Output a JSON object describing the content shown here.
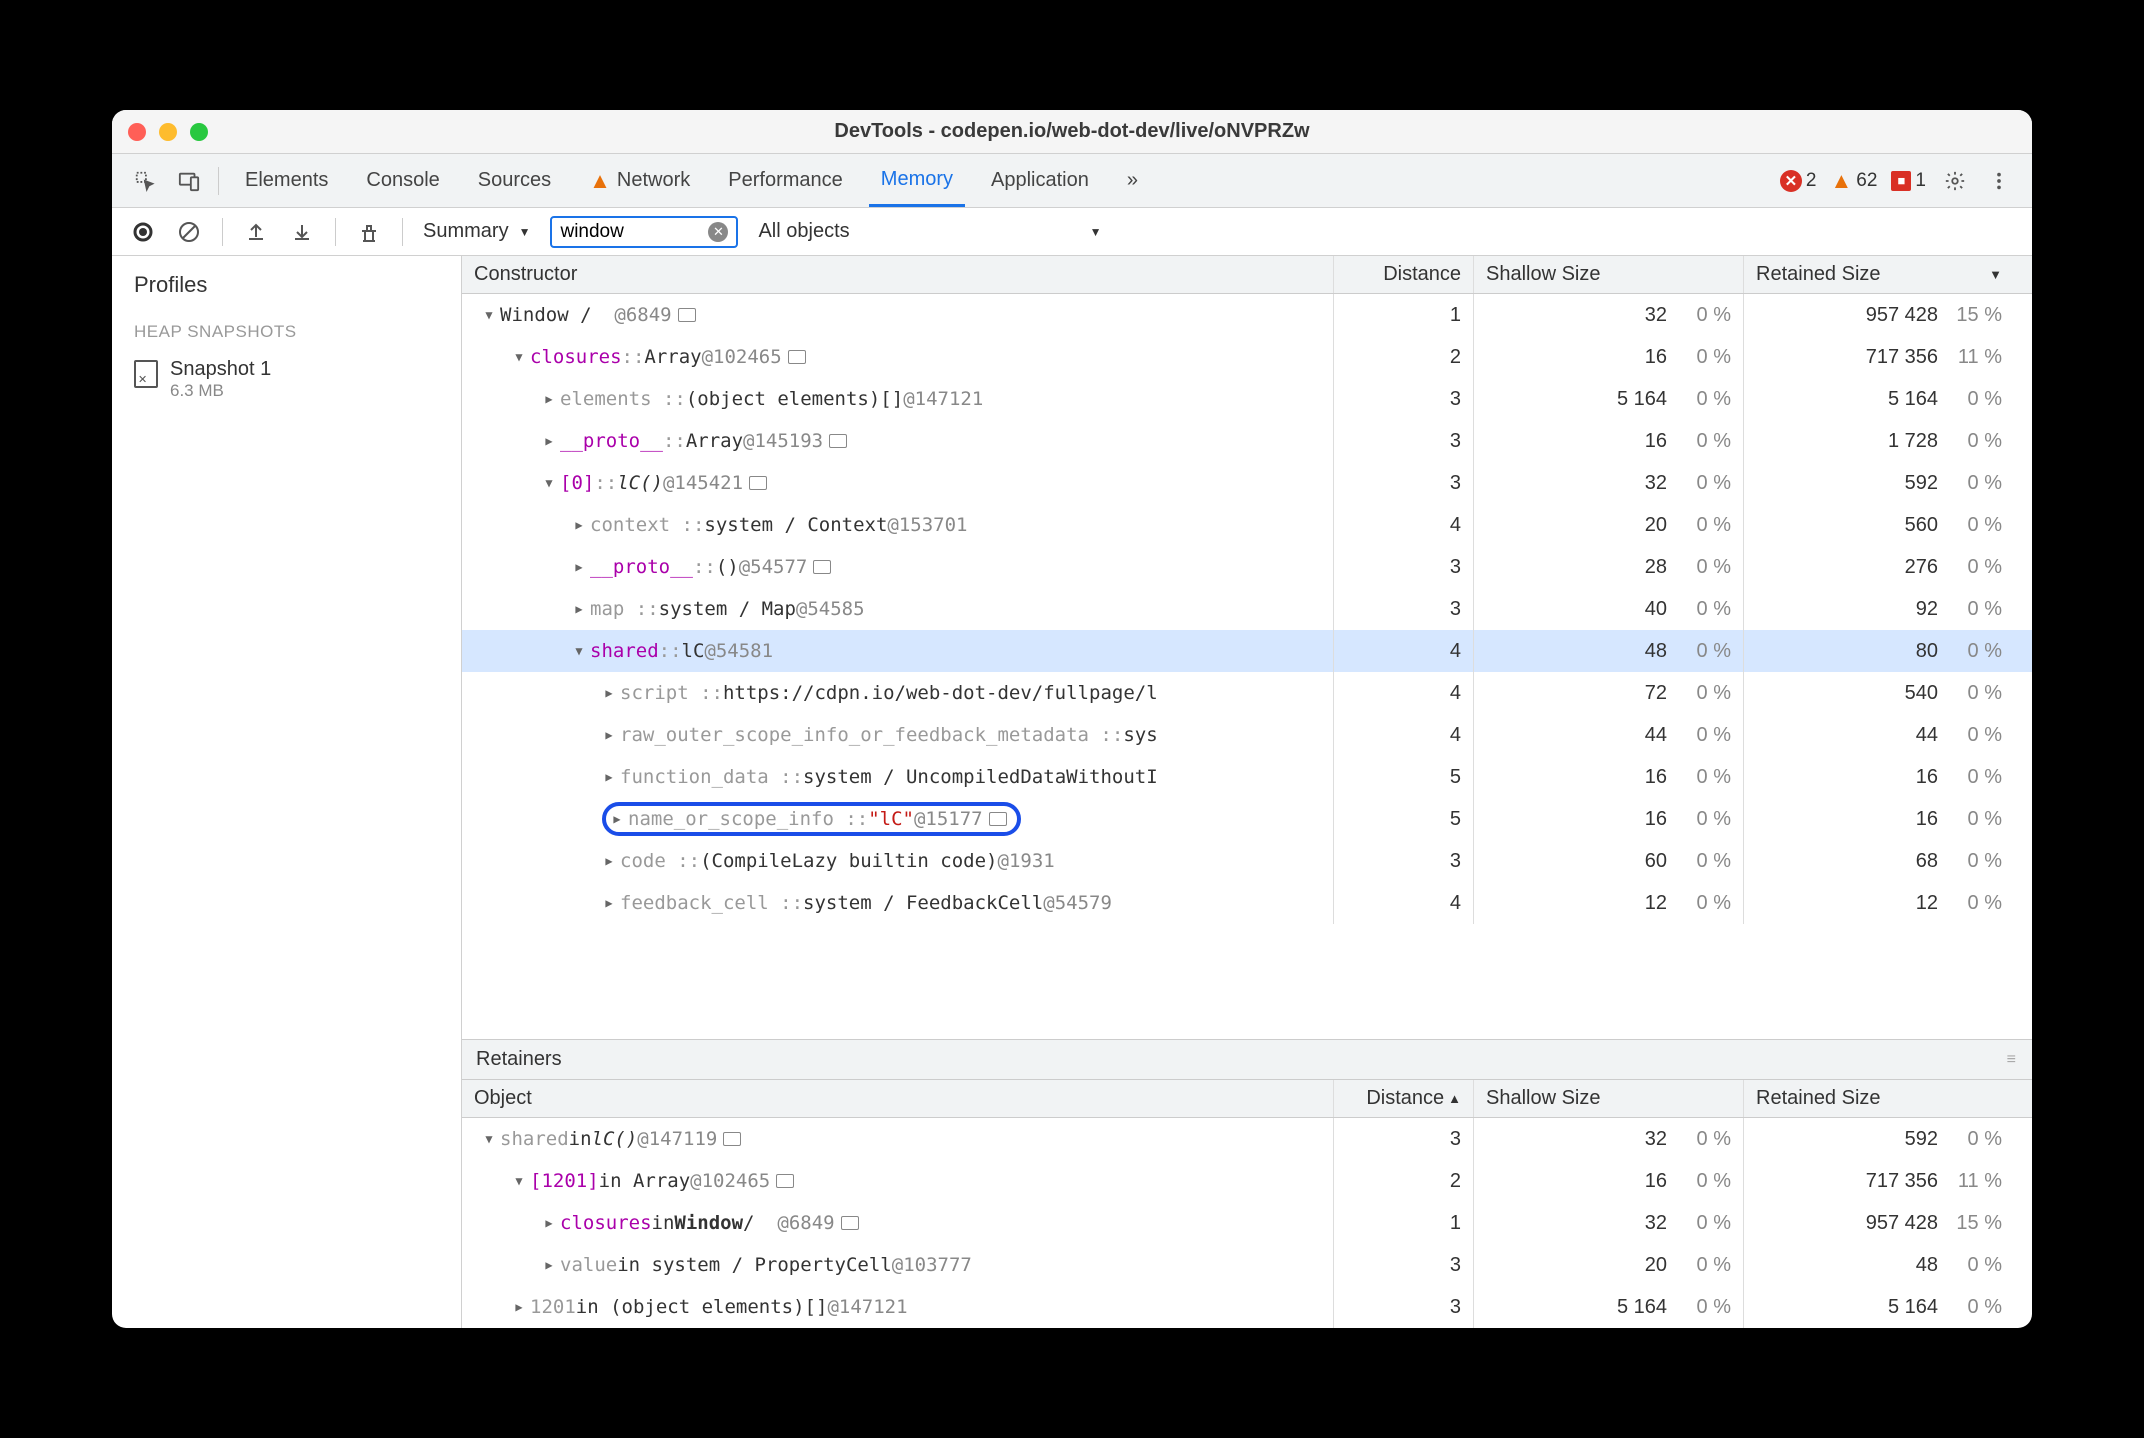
{
  "window": {
    "title": "DevTools - codepen.io/web-dot-dev/live/oNVPRZw"
  },
  "tabs": {
    "elements": "Elements",
    "console": "Console",
    "sources": "Sources",
    "network": "Network",
    "performance": "Performance",
    "memory": "Memory",
    "application": "Application",
    "more": "»"
  },
  "status": {
    "errors": "2",
    "warnings": "62",
    "issues": "1"
  },
  "toolbar": {
    "view_mode": "Summary",
    "filter_value": "window",
    "object_filter": "All objects"
  },
  "sidebar": {
    "title": "Profiles",
    "section": "HEAP SNAPSHOTS",
    "snapshot": {
      "name": "Snapshot 1",
      "size": "6.3 MB"
    }
  },
  "headers": {
    "constructor": "Constructor",
    "distance": "Distance",
    "shallow": "Shallow Size",
    "retained": "Retained Size",
    "object": "Object",
    "retainers": "Retainers"
  },
  "rows": [
    {
      "indent": 0,
      "expand": "open",
      "name_html": "Window / &nbsp;<span class='idref'>@6849</span> <span class='link-sq'></span>",
      "dist": "1",
      "shallow": "32",
      "shallow_pct": "0 %",
      "retained": "957 428",
      "retained_pct": "15 %"
    },
    {
      "indent": 1,
      "expand": "open",
      "name_html": "<span class='prop'>closures</span> <span class='gray'>::</span> Array <span class='idref'>@102465</span> <span class='link-sq'></span>",
      "dist": "2",
      "shallow": "16",
      "shallow_pct": "0 %",
      "retained": "717 356",
      "retained_pct": "11 %"
    },
    {
      "indent": 2,
      "expand": "closed",
      "name_html": "<span class='gray'>elements ::</span> (object elements)[] <span class='idref'>@147121</span>",
      "dist": "3",
      "shallow": "5 164",
      "shallow_pct": "0 %",
      "retained": "5 164",
      "retained_pct": "0 %"
    },
    {
      "indent": 2,
      "expand": "closed",
      "name_html": "<span class='prop'>__proto__</span> <span class='gray'>::</span> Array <span class='idref'>@145193</span> <span class='link-sq'></span>",
      "dist": "3",
      "shallow": "16",
      "shallow_pct": "0 %",
      "retained": "1 728",
      "retained_pct": "0 %"
    },
    {
      "indent": 2,
      "expand": "open",
      "name_html": "<span class='prop'>[0]</span> <span class='gray'>::</span> <i>lC()</i> <span class='idref'>@145421</span> <span class='link-sq'></span>",
      "dist": "3",
      "shallow": "32",
      "shallow_pct": "0 %",
      "retained": "592",
      "retained_pct": "0 %"
    },
    {
      "indent": 3,
      "expand": "closed",
      "name_html": "<span class='gray'>context ::</span> system / Context <span class='idref'>@153701</span>",
      "dist": "4",
      "shallow": "20",
      "shallow_pct": "0 %",
      "retained": "560",
      "retained_pct": "0 %"
    },
    {
      "indent": 3,
      "expand": "closed",
      "name_html": "<span class='prop'>__proto__</span> <span class='gray'>::</span> () <span class='idref'>@54577</span> <span class='link-sq'></span>",
      "dist": "3",
      "shallow": "28",
      "shallow_pct": "0 %",
      "retained": "276",
      "retained_pct": "0 %"
    },
    {
      "indent": 3,
      "expand": "closed",
      "name_html": "<span class='gray'>map ::</span> system / Map <span class='idref'>@54585</span>",
      "dist": "3",
      "shallow": "40",
      "shallow_pct": "0 %",
      "retained": "92",
      "retained_pct": "0 %"
    },
    {
      "indent": 3,
      "expand": "open",
      "selected": true,
      "name_html": "<span class='prop'>shared</span> <span class='gray'>::</span> lC <span class='idref'>@54581</span>",
      "dist": "4",
      "shallow": "48",
      "shallow_pct": "0 %",
      "retained": "80",
      "retained_pct": "0 %"
    },
    {
      "indent": 4,
      "expand": "closed",
      "name_html": "<span class='gray'>script ::</span> https://cdpn.io/web-dot-dev/fullpage/l",
      "dist": "4",
      "shallow": "72",
      "shallow_pct": "0 %",
      "retained": "540",
      "retained_pct": "0 %"
    },
    {
      "indent": 4,
      "expand": "closed",
      "name_html": "<span class='gray'>raw_outer_scope_info_or_feedback_metadata ::</span> sys",
      "dist": "4",
      "shallow": "44",
      "shallow_pct": "0 %",
      "retained": "44",
      "retained_pct": "0 %"
    },
    {
      "indent": 4,
      "expand": "closed",
      "name_html": "<span class='gray'>function_data ::</span> system / UncompiledDataWithoutI",
      "dist": "5",
      "shallow": "16",
      "shallow_pct": "0 %",
      "retained": "16",
      "retained_pct": "0 %"
    },
    {
      "indent": 4,
      "expand": "closed",
      "highlight": true,
      "name_html": "<span class='gray'>name_or_scope_info ::</span> <span class='str'>\"lC\"</span> <span class='idref'>@15177</span> <span class='link-sq'></span>",
      "dist": "5",
      "shallow": "16",
      "shallow_pct": "0 %",
      "retained": "16",
      "retained_pct": "0 %"
    },
    {
      "indent": 4,
      "expand": "closed",
      "name_html": "<span class='gray'>code ::</span> (CompileLazy builtin code) <span class='idref'>@1931</span>",
      "dist": "3",
      "shallow": "60",
      "shallow_pct": "0 %",
      "retained": "68",
      "retained_pct": "0 %"
    },
    {
      "indent": 4,
      "expand": "closed",
      "name_html": "<span class='gray'>feedback_cell ::</span> system / FeedbackCell <span class='idref'>@54579</span>",
      "dist": "4",
      "shallow": "12",
      "shallow_pct": "0 %",
      "retained": "12",
      "retained_pct": "0 %"
    }
  ],
  "retainer_rows": [
    {
      "indent": 0,
      "expand": "open",
      "name_html": "<span class='gray'>shared</span> in <i>lC()</i> <span class='idref'>@147119</span> <span class='link-sq'></span>",
      "dist": "3",
      "shallow": "32",
      "shallow_pct": "0 %",
      "retained": "592",
      "retained_pct": "0 %"
    },
    {
      "indent": 1,
      "expand": "open",
      "name_html": "<span class='prop'>[1201]</span> in Array <span class='idref'>@102465</span> <span class='link-sq'></span>",
      "dist": "2",
      "shallow": "16",
      "shallow_pct": "0 %",
      "retained": "717 356",
      "retained_pct": "11 %"
    },
    {
      "indent": 2,
      "expand": "closed",
      "name_html": "<span class='prop'>closures</span> in <b>Window</b> / &nbsp;<span class='idref'>@6849</span> <span class='link-sq'></span>",
      "dist": "1",
      "shallow": "32",
      "shallow_pct": "0 %",
      "retained": "957 428",
      "retained_pct": "15 %"
    },
    {
      "indent": 2,
      "expand": "closed",
      "name_html": "<span class='gray'>value</span> in system / PropertyCell <span class='idref'>@103777</span>",
      "dist": "3",
      "shallow": "20",
      "shallow_pct": "0 %",
      "retained": "48",
      "retained_pct": "0 %"
    },
    {
      "indent": 1,
      "expand": "closed",
      "name_html": "<span class='gray'>1201</span> in (object elements)[] <span class='idref'>@147121</span>",
      "dist": "3",
      "shallow": "5 164",
      "shallow_pct": "0 %",
      "retained": "5 164",
      "retained_pct": "0 %"
    }
  ]
}
